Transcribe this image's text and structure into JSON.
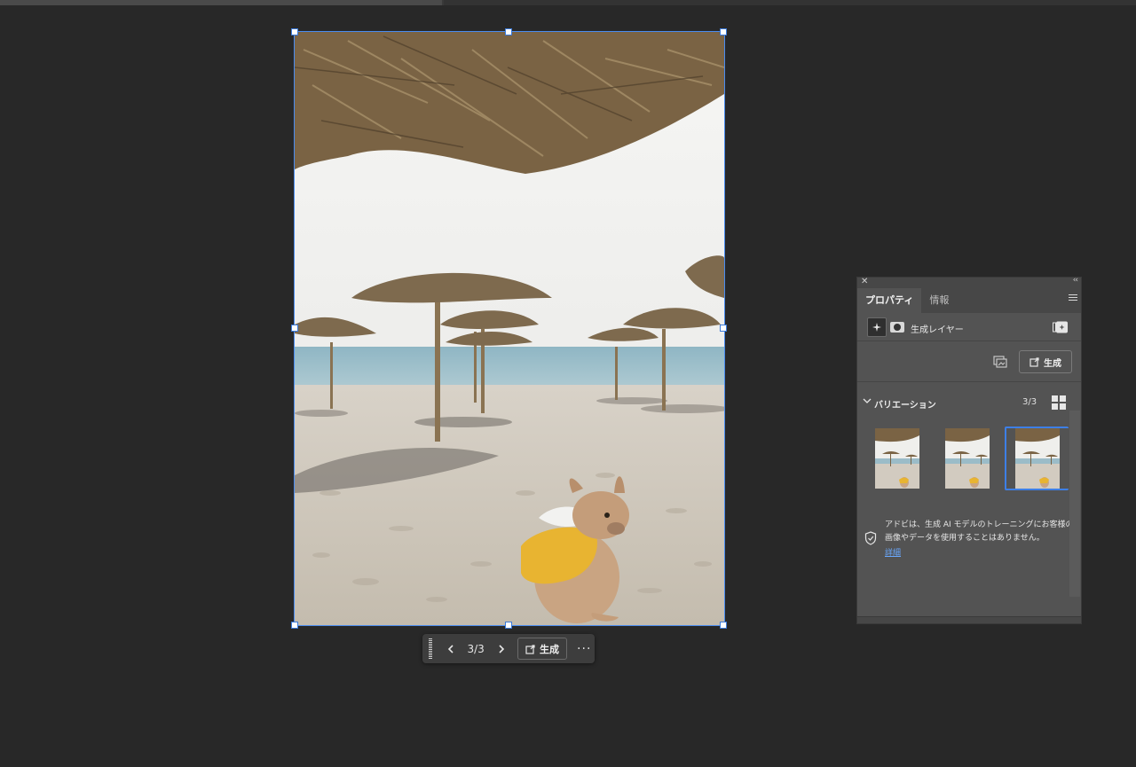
{
  "canvas": {
    "image": "beach-scene-with-dog"
  },
  "taskbar": {
    "counter": "3/3",
    "generate_label": "生成",
    "more_label": "···"
  },
  "panel": {
    "tabs": [
      {
        "label": "プロパティ",
        "active": true
      },
      {
        "label": "情報",
        "active": false
      }
    ],
    "layer_name": "生成レイヤー",
    "generate_label": "生成",
    "variations": {
      "title": "バリエーション",
      "count": "3/3",
      "selected_index": 3
    },
    "notice": {
      "text": "アドビは、生成 AI モデルのトレーニングにお客様の画像やデータを使用することはありません。",
      "link": "詳細"
    }
  },
  "colors": {
    "app_background": "#282828",
    "panel_background": "#535353",
    "selection_accent": "#3d7fe6",
    "link": "#6aa9ff"
  }
}
